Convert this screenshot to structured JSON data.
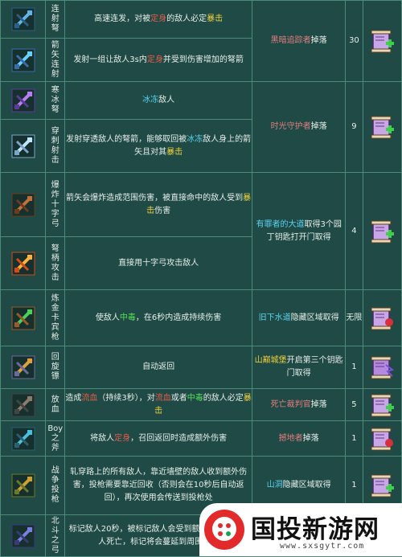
{
  "rows": [
    {
      "icon": "crossbow-arrow-icon",
      "name": [
        "连",
        "射",
        "弩"
      ],
      "desc": [
        {
          "t": "高速连发，对被"
        },
        {
          "t": "定身",
          "c": "red"
        },
        {
          "t": "的敌人必定"
        },
        {
          "t": "暴击",
          "c": "yellow"
        }
      ]
    },
    {
      "icon": "arrow-volley-icon",
      "name": [
        "箭",
        "矢",
        "连",
        "射"
      ],
      "desc": [
        {
          "t": "发射一组让敌人3s内"
        },
        {
          "t": "定身",
          "c": "red"
        },
        {
          "t": "并受到伤害增加的弩箭"
        }
      ]
    },
    {
      "icon": "frost-crossbow-icon",
      "name": [
        "寒",
        "冰",
        "弩"
      ],
      "desc": [
        {
          "t": "冰冻",
          "c": "blue"
        },
        {
          "t": "敌人"
        }
      ]
    },
    {
      "icon": "piercing-shot-icon",
      "name": [
        "穿",
        "刺",
        "射",
        "击"
      ],
      "desc": [
        {
          "t": "发射穿透敌人的弩箭，能够取回被"
        },
        {
          "t": "冰冻",
          "c": "blue"
        },
        {
          "t": "敌人身上的箭矢且对其"
        },
        {
          "t": "暴击",
          "c": "yellow"
        }
      ]
    },
    {
      "icon": "explosive-crossbow-icon",
      "name": [
        "爆",
        "炸",
        "十",
        "字",
        "弓"
      ],
      "desc": [
        {
          "t": "箭矢会爆炸造成范围伤害，被直接命中的敌人受到"
        },
        {
          "t": "暴击",
          "c": "yellow"
        },
        {
          "t": "伤害"
        }
      ]
    },
    {
      "icon": "crossbow-butt-icon",
      "name": [
        "弩",
        "柄",
        "攻",
        "击"
      ],
      "desc": [
        {
          "t": "直接用十字弓攻击敌人"
        }
      ]
    },
    {
      "icon": "alchemy-carbine-icon",
      "name": [
        "炼",
        "金",
        "卡",
        "宾",
        "枪"
      ],
      "desc": [
        {
          "t": "使敌人"
        },
        {
          "t": "中毒",
          "c": "green"
        },
        {
          "t": "，在6秒内造成持续伤害"
        }
      ]
    },
    {
      "icon": "boomerang-icon",
      "name": [
        "回",
        "旋",
        "镖"
      ],
      "desc": [
        {
          "t": "自动返回"
        }
      ]
    },
    {
      "icon": "bloodletting-axe-icon",
      "name": [
        "放",
        "血"
      ],
      "desc": [
        {
          "t": "造成"
        },
        {
          "t": "流血",
          "c": "red"
        },
        {
          "t": "（持续3秒），对"
        },
        {
          "t": "流血",
          "c": "red"
        },
        {
          "t": "或者"
        },
        {
          "t": "中毒",
          "c": "green"
        },
        {
          "t": "的敌人必定"
        },
        {
          "t": "暴击",
          "c": "yellow"
        }
      ]
    },
    {
      "icon": "boy-axe-icon",
      "name": [
        "Boy",
        "之",
        "斧"
      ],
      "desc": [
        {
          "t": "将敌人"
        },
        {
          "t": "定身",
          "c": "red"
        },
        {
          "t": "，召回返回时造成额外伤害"
        }
      ]
    },
    {
      "icon": "war-spear-icon",
      "name": [
        "战",
        "争",
        "投",
        "枪"
      ],
      "desc": [
        {
          "t": "轧穿路上的所有敌人，靠近墙壁的敌人收到额外伤害，投枪需要靠近回收（否则会在10秒后自动返回），再次使用会传送到投枪处"
        }
      ]
    },
    {
      "icon": "big-dipper-bow-icon",
      "name": [
        "北",
        "斗",
        "之",
        "弓"
      ],
      "desc": [
        {
          "t": "标记敌人20秒，被标记敌人会受到额外伤害……敌人死亡，标记将会蔓延到周围敌人"
        }
      ]
    }
  ],
  "sources": [
    {
      "parts": [
        {
          "t": "黑暗追踪者",
          "c": "rose"
        },
        {
          "t": "掉落"
        }
      ],
      "cost": "30",
      "scroll": "scroll-green-plus-icon"
    },
    {
      "parts": [
        {
          "t": "时光守护者",
          "c": "rose"
        },
        {
          "t": "掉落"
        }
      ],
      "cost": "9",
      "scroll": "scroll-green-plus-icon"
    },
    {
      "parts": [
        {
          "t": "有罪者的大道",
          "c": "blue"
        },
        {
          "t": "取得3个园丁钥匙打开门取得"
        }
      ],
      "cost": "4",
      "scroll": "scroll-green-plus-icon"
    },
    {
      "parts": [
        {
          "t": "旧下水道",
          "c": "blue"
        },
        {
          "t": "隐藏区域取得"
        }
      ],
      "cost": "无限",
      "scroll": "scroll-red-icon"
    },
    {
      "parts": [
        {
          "t": "山巅城堡",
          "c": "yellow"
        },
        {
          "t": "开启第三个钥匙门取得"
        }
      ],
      "cost": "1",
      "scroll": "scroll-purple-icon"
    },
    {
      "parts": [
        {
          "t": "死亡裁判官",
          "c": "rose"
        },
        {
          "t": "掉落"
        }
      ],
      "cost": "5",
      "scroll": "scroll-green-plus-icon"
    },
    {
      "parts": [
        {
          "t": "撼地者",
          "c": "rose"
        },
        {
          "t": "掉落"
        }
      ],
      "cost": "1",
      "scroll": "scroll-red-icon"
    },
    {
      "parts": [
        {
          "t": "山洞",
          "c": "blue"
        },
        {
          "t": "隐藏区域取得"
        }
      ],
      "cost": "1",
      "scroll": "scroll-green-plus-icon"
    },
    {
      "parts": [],
      "cost": "",
      "scroll": "scroll-green-plus-icon"
    }
  ],
  "watermark": {
    "title": "国投新游网",
    "url": "www.sxsgytr.com"
  },
  "colors": {
    "bg": "#1f4a46",
    "border": "#4e8a7a",
    "red": "#e85a4a",
    "yellow": "#f2d23a",
    "blue": "#5ad4f0",
    "green": "#55e055",
    "rose": "#e47e7e"
  }
}
